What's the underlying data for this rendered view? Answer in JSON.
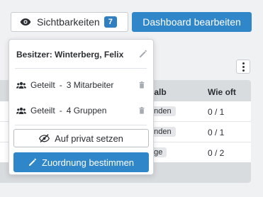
{
  "toolbar": {
    "visibility_label": "Sichtbarkeiten",
    "visibility_count": "7",
    "dashboard_label": "Dashboard bearbeiten"
  },
  "table": {
    "headers": [
      "nalb",
      "Wie oft"
    ],
    "rows": [
      {
        "tag": "unden",
        "count": "0 / 1"
      },
      {
        "tag": "unden",
        "count": "0 / 1"
      },
      {
        "tag": "age",
        "count": "0 / 2"
      }
    ]
  },
  "popover": {
    "owner_label": "Besitzer: Winterberg, Felix",
    "shares": [
      {
        "kind": "Geteilt",
        "detail": "3 Mitarbeiter"
      },
      {
        "kind": "Geteilt",
        "detail": "4 Gruppen"
      }
    ],
    "private_label": "Auf privat setzen",
    "assign_label": "Zuordnung bestimmen"
  },
  "icons": {
    "eye": "eye-icon",
    "pencil": "pencil-icon",
    "users": "users-icon",
    "trash": "trash-icon",
    "eye_slash": "eye-slash-icon",
    "kebab": "vertical-dots-icon"
  },
  "colors": {
    "primary": "#2f86c8",
    "badge": "#2f7fc1",
    "background": "#f0f1f3"
  }
}
